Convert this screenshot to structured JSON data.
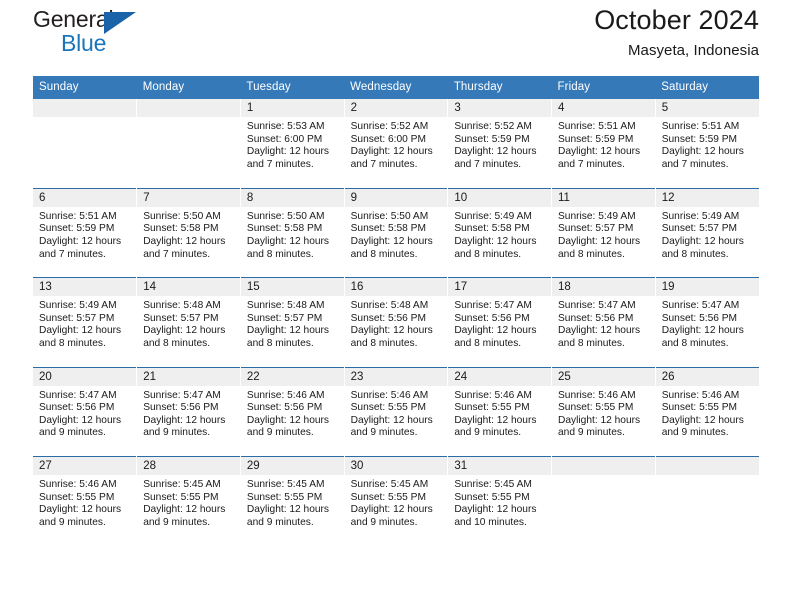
{
  "brand": {
    "name_part1": "General",
    "name_part2": "Blue",
    "flag_icon": "blue-flag-triangle",
    "color_dark": "#231f20",
    "color_blue": "#1b75bb"
  },
  "header": {
    "title": "October 2024",
    "location": "Masyeta, Indonesia"
  },
  "theme": {
    "header_blue": "#3579b8",
    "row_border_blue": "#2a6ca8",
    "daynum_band": "#efefef",
    "text": "#1a1a1a"
  },
  "weekday_headers": [
    "Sunday",
    "Monday",
    "Tuesday",
    "Wednesday",
    "Thursday",
    "Friday",
    "Saturday"
  ],
  "weeks": [
    [
      {
        "day": "",
        "sunrise": "",
        "sunset": "",
        "daylight": "",
        "empty": true
      },
      {
        "day": "",
        "sunrise": "",
        "sunset": "",
        "daylight": "",
        "empty": true
      },
      {
        "day": "1",
        "sunrise": "Sunrise: 5:53 AM",
        "sunset": "Sunset: 6:00 PM",
        "daylight": "Daylight: 12 hours and 7 minutes."
      },
      {
        "day": "2",
        "sunrise": "Sunrise: 5:52 AM",
        "sunset": "Sunset: 6:00 PM",
        "daylight": "Daylight: 12 hours and 7 minutes."
      },
      {
        "day": "3",
        "sunrise": "Sunrise: 5:52 AM",
        "sunset": "Sunset: 5:59 PM",
        "daylight": "Daylight: 12 hours and 7 minutes."
      },
      {
        "day": "4",
        "sunrise": "Sunrise: 5:51 AM",
        "sunset": "Sunset: 5:59 PM",
        "daylight": "Daylight: 12 hours and 7 minutes."
      },
      {
        "day": "5",
        "sunrise": "Sunrise: 5:51 AM",
        "sunset": "Sunset: 5:59 PM",
        "daylight": "Daylight: 12 hours and 7 minutes."
      }
    ],
    [
      {
        "day": "6",
        "sunrise": "Sunrise: 5:51 AM",
        "sunset": "Sunset: 5:59 PM",
        "daylight": "Daylight: 12 hours and 7 minutes."
      },
      {
        "day": "7",
        "sunrise": "Sunrise: 5:50 AM",
        "sunset": "Sunset: 5:58 PM",
        "daylight": "Daylight: 12 hours and 7 minutes."
      },
      {
        "day": "8",
        "sunrise": "Sunrise: 5:50 AM",
        "sunset": "Sunset: 5:58 PM",
        "daylight": "Daylight: 12 hours and 8 minutes."
      },
      {
        "day": "9",
        "sunrise": "Sunrise: 5:50 AM",
        "sunset": "Sunset: 5:58 PM",
        "daylight": "Daylight: 12 hours and 8 minutes."
      },
      {
        "day": "10",
        "sunrise": "Sunrise: 5:49 AM",
        "sunset": "Sunset: 5:58 PM",
        "daylight": "Daylight: 12 hours and 8 minutes."
      },
      {
        "day": "11",
        "sunrise": "Sunrise: 5:49 AM",
        "sunset": "Sunset: 5:57 PM",
        "daylight": "Daylight: 12 hours and 8 minutes."
      },
      {
        "day": "12",
        "sunrise": "Sunrise: 5:49 AM",
        "sunset": "Sunset: 5:57 PM",
        "daylight": "Daylight: 12 hours and 8 minutes."
      }
    ],
    [
      {
        "day": "13",
        "sunrise": "Sunrise: 5:49 AM",
        "sunset": "Sunset: 5:57 PM",
        "daylight": "Daylight: 12 hours and 8 minutes."
      },
      {
        "day": "14",
        "sunrise": "Sunrise: 5:48 AM",
        "sunset": "Sunset: 5:57 PM",
        "daylight": "Daylight: 12 hours and 8 minutes."
      },
      {
        "day": "15",
        "sunrise": "Sunrise: 5:48 AM",
        "sunset": "Sunset: 5:57 PM",
        "daylight": "Daylight: 12 hours and 8 minutes."
      },
      {
        "day": "16",
        "sunrise": "Sunrise: 5:48 AM",
        "sunset": "Sunset: 5:56 PM",
        "daylight": "Daylight: 12 hours and 8 minutes."
      },
      {
        "day": "17",
        "sunrise": "Sunrise: 5:47 AM",
        "sunset": "Sunset: 5:56 PM",
        "daylight": "Daylight: 12 hours and 8 minutes."
      },
      {
        "day": "18",
        "sunrise": "Sunrise: 5:47 AM",
        "sunset": "Sunset: 5:56 PM",
        "daylight": "Daylight: 12 hours and 8 minutes."
      },
      {
        "day": "19",
        "sunrise": "Sunrise: 5:47 AM",
        "sunset": "Sunset: 5:56 PM",
        "daylight": "Daylight: 12 hours and 8 minutes."
      }
    ],
    [
      {
        "day": "20",
        "sunrise": "Sunrise: 5:47 AM",
        "sunset": "Sunset: 5:56 PM",
        "daylight": "Daylight: 12 hours and 9 minutes."
      },
      {
        "day": "21",
        "sunrise": "Sunrise: 5:47 AM",
        "sunset": "Sunset: 5:56 PM",
        "daylight": "Daylight: 12 hours and 9 minutes."
      },
      {
        "day": "22",
        "sunrise": "Sunrise: 5:46 AM",
        "sunset": "Sunset: 5:56 PM",
        "daylight": "Daylight: 12 hours and 9 minutes."
      },
      {
        "day": "23",
        "sunrise": "Sunrise: 5:46 AM",
        "sunset": "Sunset: 5:55 PM",
        "daylight": "Daylight: 12 hours and 9 minutes."
      },
      {
        "day": "24",
        "sunrise": "Sunrise: 5:46 AM",
        "sunset": "Sunset: 5:55 PM",
        "daylight": "Daylight: 12 hours and 9 minutes."
      },
      {
        "day": "25",
        "sunrise": "Sunrise: 5:46 AM",
        "sunset": "Sunset: 5:55 PM",
        "daylight": "Daylight: 12 hours and 9 minutes."
      },
      {
        "day": "26",
        "sunrise": "Sunrise: 5:46 AM",
        "sunset": "Sunset: 5:55 PM",
        "daylight": "Daylight: 12 hours and 9 minutes."
      }
    ],
    [
      {
        "day": "27",
        "sunrise": "Sunrise: 5:46 AM",
        "sunset": "Sunset: 5:55 PM",
        "daylight": "Daylight: 12 hours and 9 minutes."
      },
      {
        "day": "28",
        "sunrise": "Sunrise: 5:45 AM",
        "sunset": "Sunset: 5:55 PM",
        "daylight": "Daylight: 12 hours and 9 minutes."
      },
      {
        "day": "29",
        "sunrise": "Sunrise: 5:45 AM",
        "sunset": "Sunset: 5:55 PM",
        "daylight": "Daylight: 12 hours and 9 minutes."
      },
      {
        "day": "30",
        "sunrise": "Sunrise: 5:45 AM",
        "sunset": "Sunset: 5:55 PM",
        "daylight": "Daylight: 12 hours and 9 minutes."
      },
      {
        "day": "31",
        "sunrise": "Sunrise: 5:45 AM",
        "sunset": "Sunset: 5:55 PM",
        "daylight": "Daylight: 12 hours and 10 minutes."
      },
      {
        "day": "",
        "sunrise": "",
        "sunset": "",
        "daylight": "",
        "empty": true
      },
      {
        "day": "",
        "sunrise": "",
        "sunset": "",
        "daylight": "",
        "empty": true
      }
    ]
  ]
}
